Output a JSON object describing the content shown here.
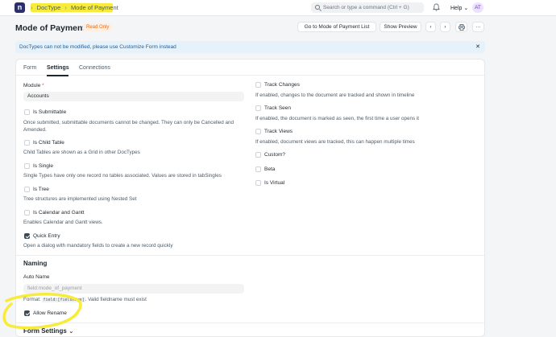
{
  "navbar": {
    "logo_letter": "n",
    "breadcrumbs": [
      "DocType",
      "Mode of Payment"
    ],
    "search_placeholder": "Search or type a command (Ctrl + G)",
    "help_label": "Help",
    "avatar_initials": "AT"
  },
  "page": {
    "title": "Mode of Payment",
    "status_badge": "Read Only",
    "go_to_button": "Go to Mode of Payment List",
    "show_preview_button": "Show Preview"
  },
  "alert": {
    "text_prefix": "DocTypes can not be modified, please use ",
    "link": "Customize Form",
    "text_suffix": " instead"
  },
  "tabs": [
    "Form",
    "Settings",
    "Connections"
  ],
  "settings": {
    "module_label": "Module",
    "module_value": "Accounts",
    "left_checks": [
      {
        "label": "Is Submittable",
        "checked": false,
        "desc": "Once submitted, submittable documents cannot be changed. They can only be Cancelled and Amended."
      },
      {
        "label": "Is Child Table",
        "checked": false,
        "desc": "Child Tables are shown as a Grid in other DocTypes"
      },
      {
        "label": "Is Single",
        "checked": false,
        "desc": "Single Types have only one record no tables associated. Values are stored in tabSingles"
      },
      {
        "label": "Is Tree",
        "checked": false,
        "desc": "Tree structures are implemented using Nested Set"
      },
      {
        "label": "Is Calendar and Gantt",
        "checked": false,
        "desc": "Enables Calendar and Gantt views."
      },
      {
        "label": "Quick Entry",
        "checked": true,
        "desc": "Open a dialog with mandatory fields to create a new record quickly"
      }
    ],
    "right_checks": [
      {
        "label": "Track Changes",
        "checked": false,
        "desc": "If enabled, changes to the document are tracked and shown in timeline"
      },
      {
        "label": "Track Seen",
        "checked": false,
        "desc": "If enabled, the document is marked as seen, the first time a user opens it"
      },
      {
        "label": "Track Views",
        "checked": false,
        "desc": "If enabled, document views are tracked, this can happen multiple times"
      },
      {
        "label": "Custom?",
        "checked": false,
        "desc": ""
      },
      {
        "label": "Beta",
        "checked": false,
        "desc": ""
      },
      {
        "label": "Is Virtual",
        "checked": false,
        "desc": ""
      }
    ]
  },
  "naming": {
    "section_title": "Naming",
    "auto_name_label": "Auto Name",
    "auto_name_value": "field:mode_of_payment",
    "format_prefix": "Format: ",
    "format_code": "field:[fieldname]",
    "format_suffix": ". Valid fieldname must exist",
    "allow_rename_label": "Allow Rename",
    "allow_rename_checked": true
  },
  "form_settings": {
    "section_title": "Form Settings"
  },
  "colors": {
    "highlight": "#f7ec3b",
    "brand": "#2d2f6b",
    "badge_text": "#e86c13",
    "alert_bg": "#e6f2fb"
  }
}
